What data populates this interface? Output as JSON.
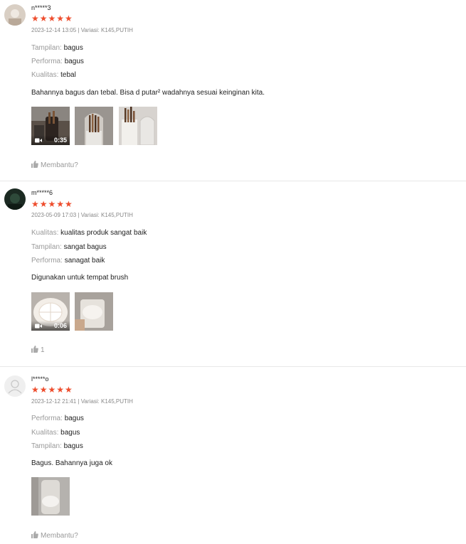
{
  "reviews": [
    {
      "username": "n*****3",
      "stars": "★★★★★",
      "meta": "2023-12-14 13:05 | Variasi: K145,PUTIH",
      "attributes": [
        {
          "key": "Tampilan:",
          "value": "bagus"
        },
        {
          "key": "Performa:",
          "value": "bagus"
        },
        {
          "key": "Kualitas:",
          "value": "tebal"
        }
      ],
      "comment": "Bahannya bagus dan tebal. Bisa d putar² wadahnya sesuai keinginan kita.",
      "video_duration": "0:35",
      "helpful": "Membantu?"
    },
    {
      "username": "m*****6",
      "stars": "★★★★★",
      "meta": "2023-05-09 17:03 | Variasi: K145,PUTIH",
      "attributes": [
        {
          "key": "Kualitas:",
          "value": "kualitas produk sangat baik"
        },
        {
          "key": "Tampilan:",
          "value": "sangat bagus"
        },
        {
          "key": "Performa:",
          "value": "sanagat baik"
        }
      ],
      "comment": "Digunakan untuk tempat brush",
      "video_duration": "0:06",
      "helpful": "1"
    },
    {
      "username": "l*****o",
      "stars": "★★★★★",
      "meta": "2023-12-12 21:41 | Variasi: K145,PUTIH",
      "attributes": [
        {
          "key": "Performa:",
          "value": "bagus"
        },
        {
          "key": "Kualitas:",
          "value": "bagus"
        },
        {
          "key": "Tampilan:",
          "value": "bagus"
        }
      ],
      "comment": "Bagus. Bahannya juga ok",
      "helpful": "Membantu?"
    }
  ],
  "colors": {
    "star": "#ee4d2d",
    "muted": "#999999",
    "divider": "#e8e8e8"
  },
  "icons": [
    "avatar",
    "star-icon",
    "thumbs-up-icon",
    "video-camera-icon"
  ]
}
